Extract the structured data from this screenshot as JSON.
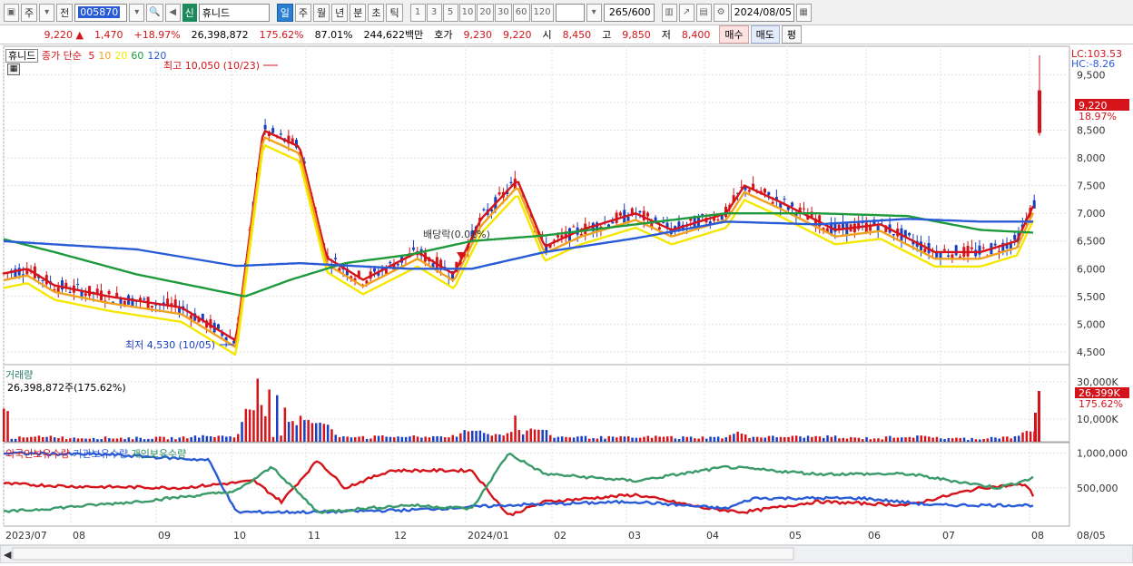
{
  "toolbar": {
    "type_select": "주",
    "jeon": "전",
    "code": "005870",
    "sin": "신",
    "stock_name": "휴니드",
    "periods": [
      "일",
      "주",
      "월",
      "년",
      "분",
      "초",
      "틱"
    ],
    "active_period": "일",
    "intervals": [
      "1",
      "3",
      "5",
      "10",
      "20",
      "30",
      "60",
      "120"
    ],
    "count_current": "265",
    "count_total": "/600",
    "date": "2024/08/05"
  },
  "info": {
    "price": "9,220",
    "change": "1,470",
    "change_pct": "+18.97%",
    "volume": "26,398,872",
    "volume_ratio": "175.62%",
    "rate": "87.01%",
    "amount": "244,622백만",
    "quote_label": "호가",
    "ask": "9,230",
    "bid": "9,220",
    "open_label": "시",
    "open": "8,450",
    "high_label": "고",
    "high": "9,850",
    "low_label": "저",
    "low": "8,400",
    "buy": "매수",
    "sell": "매도",
    "avg": "평"
  },
  "price_panel": {
    "legend_name": "휴니드",
    "legend_label": "종가 단순",
    "ma_periods": [
      "5",
      "10",
      "20",
      "60",
      "120"
    ],
    "ma_colors": [
      "#d4141a",
      "#f0a21e",
      "#f5e800",
      "#1e9a3c",
      "#2a5bd7"
    ],
    "lc": "LC:103.53",
    "hc": "HC:-8.26",
    "high_annot": "최고 10,050 (10/23)",
    "low_annot": "최저 4,530 (10/05)",
    "dividend_annot": "배당락(0.01%)",
    "last_price_tag": "9,220",
    "last_pct_tag": "18.97%",
    "y_ticks": [
      "9,500",
      "9,000",
      "8,500",
      "8,000",
      "7,500",
      "7,000",
      "6,500",
      "6,000",
      "5,500",
      "5,000",
      "4,500"
    ]
  },
  "volume_panel": {
    "title": "거래량",
    "value": "26,398,872주(175.62%)",
    "y_ticks": [
      "30,000K",
      "10,000K"
    ],
    "tag_value": "26,399K",
    "tag_pct": "175.62%"
  },
  "holding_panel": {
    "labels": [
      "외국인보유수량",
      "기관보유수량",
      "개인보유수량"
    ],
    "y_ticks": [
      "1,000,000",
      "500,000"
    ]
  },
  "x_axis": {
    "labels": [
      "2023/07",
      "08",
      "09",
      "10",
      "11",
      "12",
      "2024/01",
      "02",
      "03",
      "04",
      "05",
      "06",
      "07",
      "08"
    ],
    "end_label": "08/05"
  },
  "colors": {
    "up": "#d4141a",
    "down": "#1a3fbf",
    "grid": "#e2e2e2"
  },
  "chart_data": {
    "type": "line",
    "title": "휴니드",
    "ylim": [
      4400,
      9900
    ],
    "ma_anchor_points": {
      "ma5": [
        [
          0,
          5900
        ],
        [
          30,
          6000
        ],
        [
          60,
          5700
        ],
        [
          120,
          5500
        ],
        [
          200,
          5300
        ],
        [
          260,
          4700
        ],
        [
          290,
          8500
        ],
        [
          330,
          8200
        ],
        [
          360,
          6200
        ],
        [
          400,
          5800
        ],
        [
          460,
          6300
        ],
        [
          500,
          5900
        ],
        [
          530,
          6900
        ],
        [
          570,
          7600
        ],
        [
          600,
          6400
        ],
        [
          640,
          6700
        ],
        [
          700,
          7000
        ],
        [
          740,
          6700
        ],
        [
          800,
          7000
        ],
        [
          820,
          7500
        ],
        [
          860,
          7200
        ],
        [
          920,
          6700
        ],
        [
          970,
          6800
        ],
        [
          1030,
          6300
        ],
        [
          1080,
          6300
        ],
        [
          1120,
          6500
        ],
        [
          1140,
          7200
        ]
      ],
      "ma60": [
        [
          0,
          6550
        ],
        [
          60,
          6300
        ],
        [
          150,
          5900
        ],
        [
          270,
          5500
        ],
        [
          320,
          5800
        ],
        [
          380,
          6100
        ],
        [
          450,
          6250
        ],
        [
          520,
          6500
        ],
        [
          600,
          6600
        ],
        [
          700,
          6800
        ],
        [
          800,
          7000
        ],
        [
          900,
          7000
        ],
        [
          1000,
          6950
        ],
        [
          1080,
          6700
        ],
        [
          1140,
          6650
        ]
      ],
      "ma120": [
        [
          0,
          6500
        ],
        [
          150,
          6350
        ],
        [
          260,
          6050
        ],
        [
          330,
          6100
        ],
        [
          450,
          6000
        ],
        [
          520,
          6000
        ],
        [
          600,
          6300
        ],
        [
          700,
          6550
        ],
        [
          800,
          6850
        ],
        [
          900,
          6800
        ],
        [
          1000,
          6900
        ],
        [
          1080,
          6850
        ],
        [
          1140,
          6850
        ]
      ]
    }
  }
}
